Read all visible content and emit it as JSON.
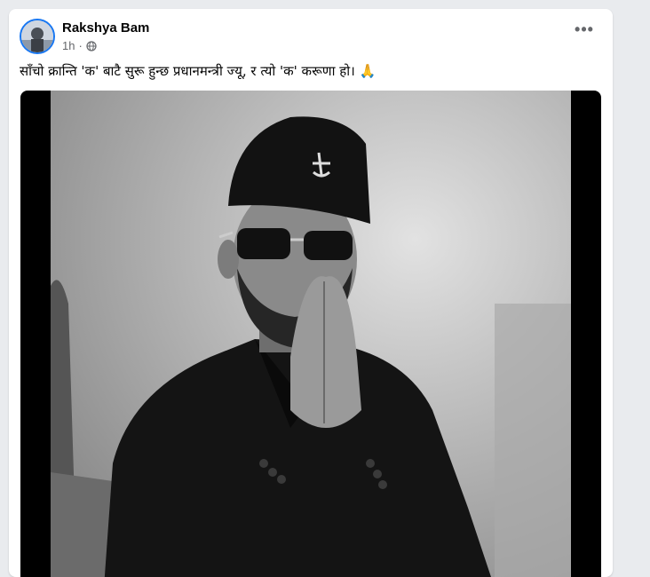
{
  "post": {
    "author": "Rakshya Bam",
    "time": "1h",
    "audience_icon": "globe-icon",
    "menu_icon": "more-options-icon",
    "caption": "साँचो क्रान्ति 'क' बाटै सुरू हुन्छ प्रधानमन्त्री ज्यू, र त्यो 'क' करूणा हो। 🙏",
    "accent_color": "#1877f2",
    "photo": {
      "description_icon": "photo-of-man-namaste"
    }
  }
}
